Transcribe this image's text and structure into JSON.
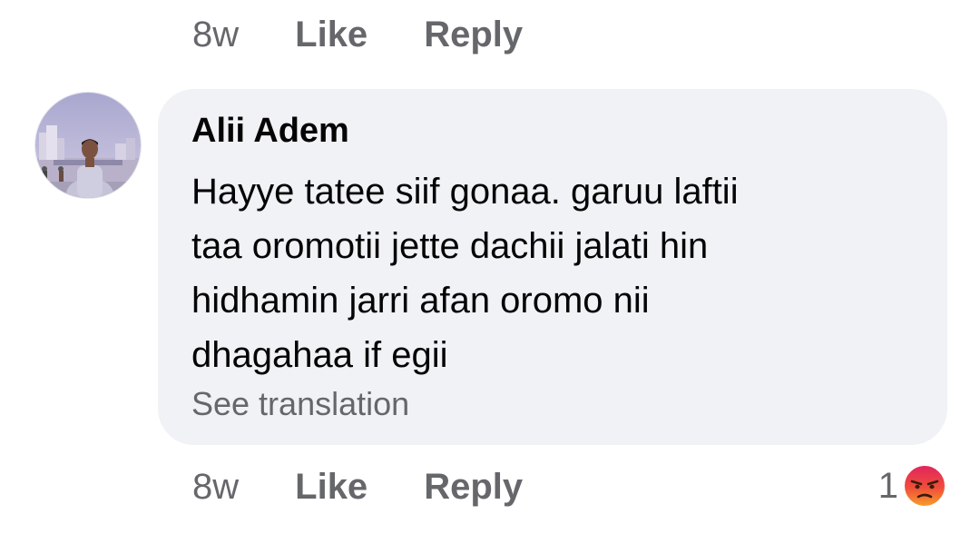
{
  "previous_comment": {
    "time": "8w",
    "like_label": "Like",
    "reply_label": "Reply"
  },
  "comment": {
    "author": "Alii Adem",
    "text": "Hayye tatee siif gonaa. garuu laftii taa oromotii jette dachii jalati hin hidhamin jarri afan oromo nii dhagahaa if egii",
    "text_lines": [
      "Hayye tatee siif gonaa. garuu laftii",
      "taa oromotii jette dachii jalati hin",
      "hidhamin jarri afan oromo nii",
      "dhagahaa if egii"
    ],
    "see_translation": "See translation",
    "time": "8w",
    "like_label": "Like",
    "reply_label": "Reply",
    "reaction": {
      "count": "1",
      "icon": "angry-emoji-icon",
      "color": "#e9710f"
    }
  },
  "colors": {
    "bubble_background": "#f0f2f5",
    "secondary_text": "#65676b",
    "primary_text": "#050505"
  }
}
